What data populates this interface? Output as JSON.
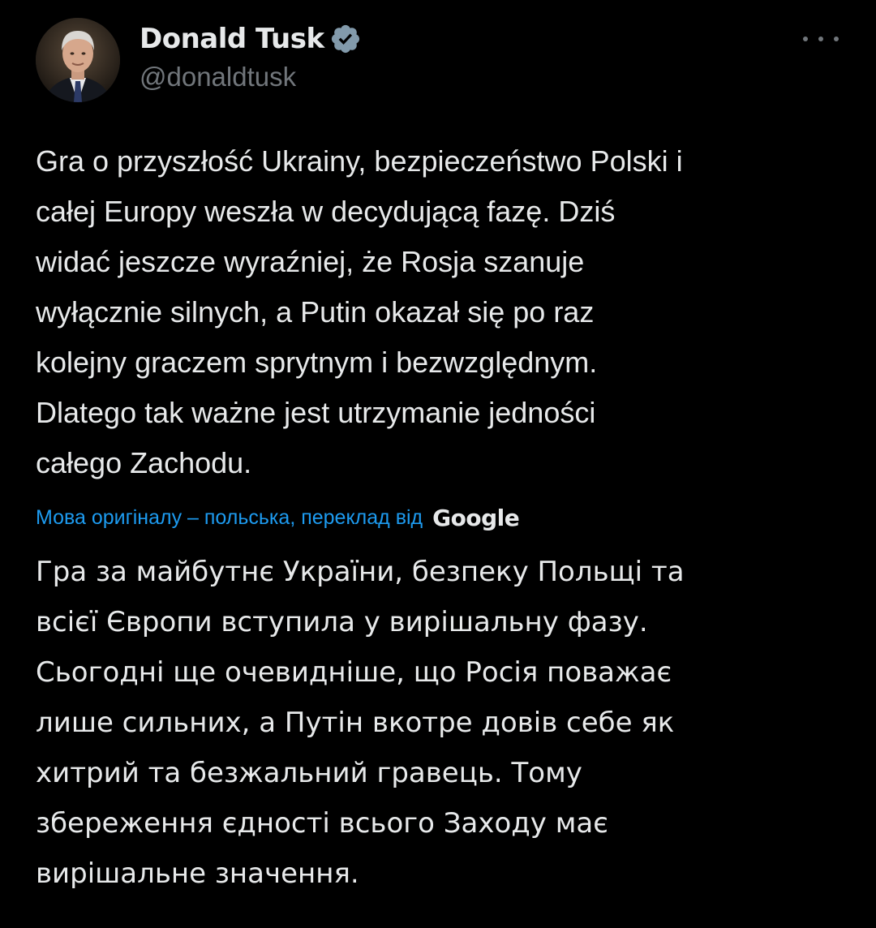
{
  "author": {
    "display_name": "Donald Tusk",
    "handle": "@donaldtusk",
    "verified": true,
    "avatar_icon": "profile-photo",
    "verified_icon": "verified-badge-icon",
    "verified_color": "#829aab"
  },
  "menu": {
    "more_icon": "more-options-icon"
  },
  "tweet": {
    "text": "Gra o przyszłość Ukrainy, bezpieczeństwo Polski i\ncałej Europy weszła w decydującą fazę. Dziś\nwidać jeszcze wyraźniej, że Rosja szanuje\nwyłącznie silnych, a Putin okazał się po raz\nkolejny graczem sprytnym i bezwzględnym.\nDlatego tak ważne jest utrzymanie jedności\ncałego Zachodu."
  },
  "translation": {
    "label": "Мова оригіналу – польська, переклад від",
    "provider": "Google",
    "text": "Гра за майбутнє України, безпеку Польщі та\nвсієї Європи вступила у вирішальну фазу.\nСьогодні ще очевидніше, що Росія поважає\nлише сильних, а Путін вкотре довів себе як\nхитрий та безжальний гравець. Тому\nзбереження єдності всього Заходу має\nвирішальне значення."
  },
  "colors": {
    "background": "#000000",
    "text": "#e7e9ea",
    "secondary": "#71767b",
    "link": "#1d9bf0"
  }
}
